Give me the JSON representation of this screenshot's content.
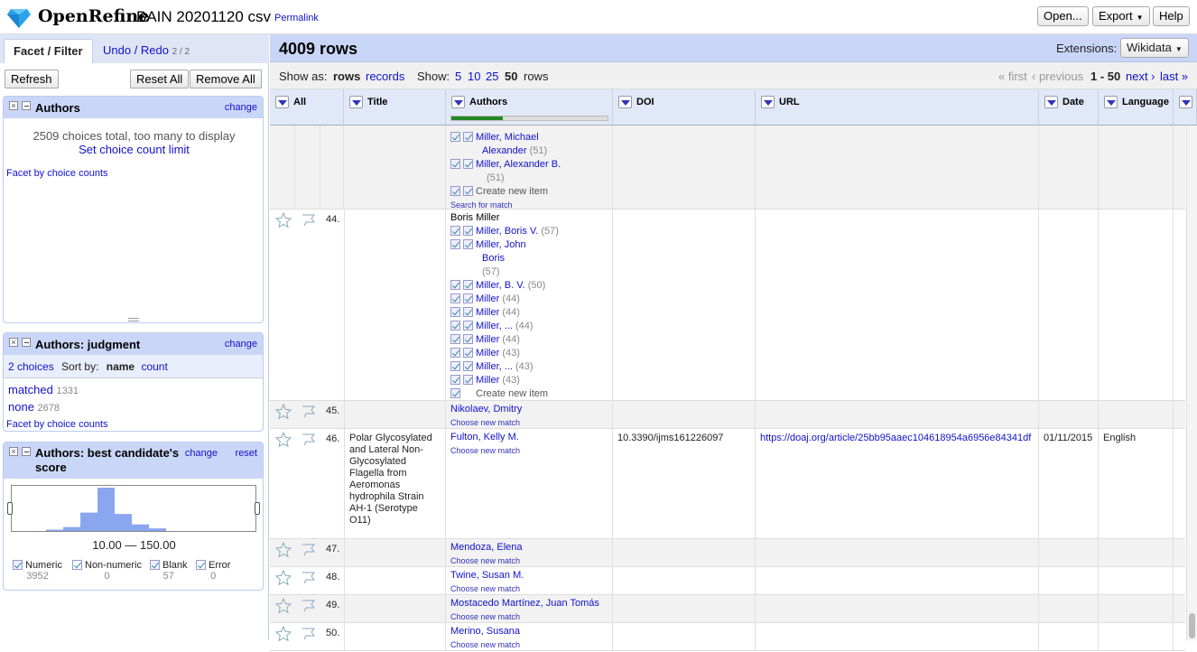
{
  "header": {
    "app_name": "OpenRefine",
    "project_name": "BAIN 20201120 csv",
    "permalink": "Permalink",
    "open_btn": "Open...",
    "export_btn": "Export",
    "help_btn": "Help"
  },
  "left": {
    "tab_facet": "Facet / Filter",
    "tab_undo": "Undo / Redo",
    "tab_undo_count": "2 / 2",
    "refresh": "Refresh",
    "reset_all": "Reset All",
    "remove_all": "Remove All",
    "facet1": {
      "title": "Authors",
      "change": "change",
      "msg": "2509 choices total, too many to display",
      "limit_link": "Set choice count limit",
      "by_counts": "Facet by choice counts"
    },
    "facet2": {
      "title": "Authors: judgment",
      "change": "change",
      "choices": "2 choices",
      "sort_by": "Sort by:",
      "sort_name": "name",
      "sort_count": "count",
      "items": [
        {
          "label": "matched",
          "count": "1331"
        },
        {
          "label": "none",
          "count": "2678"
        }
      ],
      "by_counts": "Facet by choice counts"
    },
    "facet3": {
      "title": "Authors: best candidate's score",
      "change": "change",
      "reset": "reset",
      "range": "10.00 — 150.00",
      "histogram": [
        1,
        3,
        14,
        33,
        13,
        5,
        2
      ],
      "checks": [
        {
          "label": "Numeric",
          "count": "3952",
          "checked": true
        },
        {
          "label": "Non-numeric",
          "count": "0",
          "checked": false
        },
        {
          "label": "Blank",
          "count": "57",
          "checked": true
        },
        {
          "label": "Error",
          "count": "0",
          "checked": false
        }
      ]
    }
  },
  "grid": {
    "row_count": "4009 rows",
    "extensions_label": "Extensions:",
    "extensions_value": "Wikidata",
    "show_as": "Show as:",
    "rows": "rows",
    "records": "records",
    "show": "Show:",
    "page_sizes": [
      "5",
      "10",
      "25",
      "50"
    ],
    "rows_suffix": "rows",
    "first": "« first",
    "previous": "‹ previous",
    "range": "1 - 50",
    "next": "next ›",
    "last": "last »",
    "columns": [
      "All",
      "Title",
      "Authors",
      "DOI",
      "URL",
      "Date",
      "Language"
    ],
    "progress": 0.33,
    "search_match": "Search for match",
    "create_new": "Create new item",
    "choose_new": "Choose new match",
    "top_partial": [
      {
        "name": "Miller, Michael",
        "name2": "Alexander",
        "score": "(51)"
      },
      {
        "name": "Miller, Alexander B.",
        "name2": "",
        "score": "(51)"
      }
    ],
    "row44": {
      "num": "44.",
      "value": "Boris Miller",
      "cands": [
        {
          "name": "Miller, Boris V.",
          "name2": "",
          "score": "(57)"
        },
        {
          "name": "Miller, John",
          "name2": "Boris",
          "score": "(57)"
        },
        {
          "name": "Miller, B. V.",
          "name2": "",
          "score": "(50)"
        },
        {
          "name": "Miller",
          "name2": "",
          "score": "(44)"
        },
        {
          "name": "Miller",
          "name2": "",
          "score": "(44)"
        },
        {
          "name": "Miller, ...",
          "name2": "",
          "score": "(44)"
        },
        {
          "name": "Miller",
          "name2": "",
          "score": "(44)"
        },
        {
          "name": "Miller",
          "name2": "",
          "score": "(43)"
        },
        {
          "name": "Miller, ...",
          "name2": "",
          "score": "(43)"
        },
        {
          "name": "Miller",
          "name2": "",
          "score": "(43)"
        }
      ]
    },
    "rows_list": [
      {
        "num": "45.",
        "author": "Nikolaev, Dmitry"
      },
      {
        "num": "46.",
        "author": "Fulton, Kelly M."
      },
      {
        "num": "47.",
        "author": "Mendoza, Elena"
      },
      {
        "num": "48.",
        "author": "Twine, Susan M."
      },
      {
        "num": "49.",
        "author": "Mostacedo Martínez, Juan Tomás"
      },
      {
        "num": "50.",
        "author": "Merino, Susana"
      }
    ],
    "row46_title": "Polar Glycosylated and Lateral Non-Glycosylated Flagella from Aeromonas hydrophila Strain AH-1 (Serotype O11)",
    "row46_doi": "10.3390/ijms161226097",
    "row46_url": "https://doaj.org/article/25bb95aaec104618954a6956e84341df",
    "row46_date": "01/11/2015",
    "row46_lang": "English"
  }
}
